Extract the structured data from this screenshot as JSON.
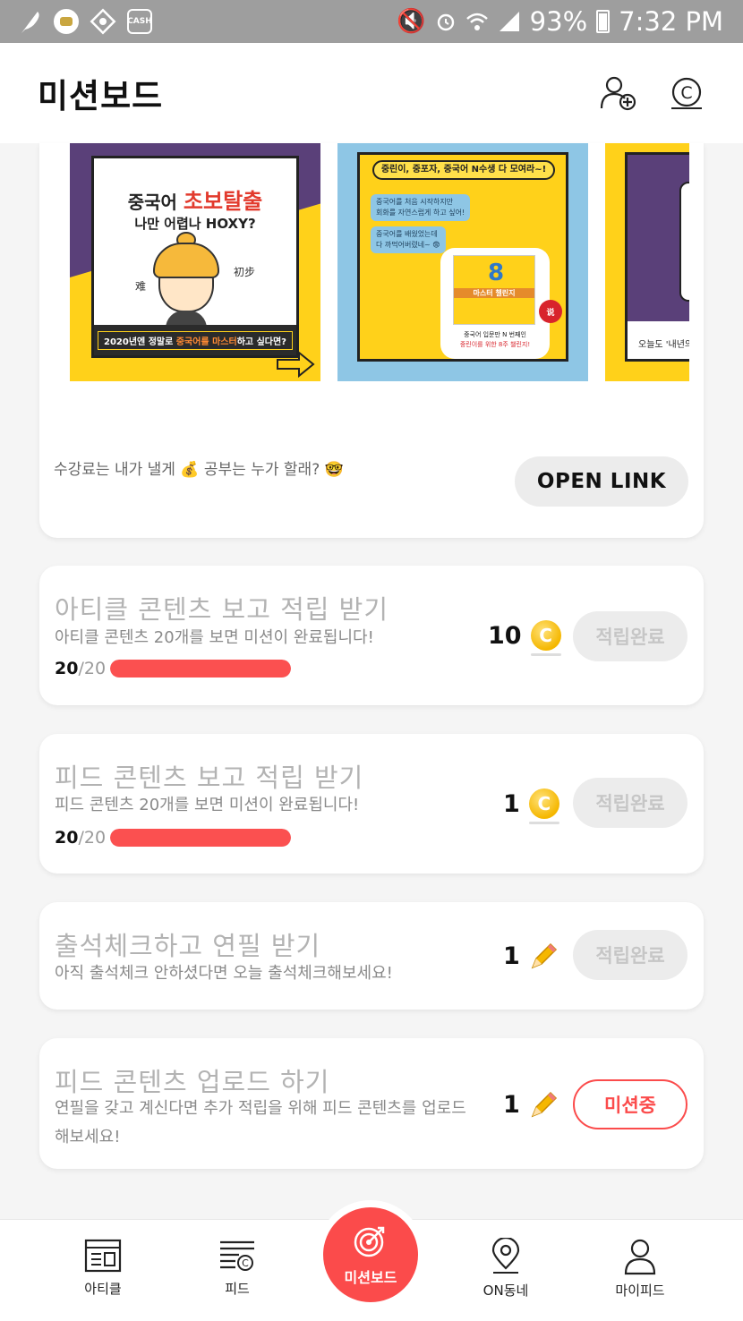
{
  "status_bar": {
    "battery": "93%",
    "time": "7:32 PM",
    "left_icons": [
      "feather-icon",
      "coin-app-icon",
      "diamond-app-icon",
      "cash-tv-icon"
    ],
    "cash_label": "CASH",
    "right_icons": [
      "mute-icon",
      "alarm-icon",
      "wifi-icon",
      "signal-icon",
      "battery-icon"
    ]
  },
  "header": {
    "title": "미션보드",
    "actions": [
      "add-friend-icon",
      "coin-icon"
    ],
    "coin_glyph": "C"
  },
  "banner": {
    "caption": "수강료는 내가 낼게 💰 공부는 누가 할래? 🤓",
    "open_link_label": "OPEN LINK",
    "slides": {
      "slide1": {
        "title_prefix": "중국어",
        "title_highlight": "초보탈출",
        "subtitle": "나만 어렵나 HOXY?",
        "side_left": "难",
        "side_right": "初步",
        "footer_a": "2020년엔 정말로 ",
        "footer_highlight": "중국어를 마스터",
        "footer_b": "하고 싶다면?"
      },
      "slide2": {
        "header": "중린이, 중포자, 중국어 N수생 다 모여라~!",
        "chat1_line1": "중국어를 처음 시작하지만",
        "chat1_line2": "회화를 자연스럽게 하고 싶어!",
        "chat2_line1": "중국어를 배웠었는데",
        "chat2_line2": "다 까먹어버렸네~ 😨",
        "poster_number": "8",
        "poster_text": "마스터 챌린지",
        "caption1": "중국어 입문만 N 번째인",
        "caption2": "중린이를 위한 8주 챌린지!",
        "logo": "说"
      },
      "slide3": {
        "caption": "오늘도 '내년의"
      }
    }
  },
  "missions": [
    {
      "title": "아티클 콘텐츠 보고 적립 받기",
      "desc": "아티클 콘텐츠 20개를 보면 미션이 완료됩니다!",
      "progress_current": "20",
      "progress_total": "/20",
      "progress_ratio": 1.0,
      "reward": "10",
      "reward_type": "coin",
      "button": "적립완료",
      "status": "done"
    },
    {
      "title": "피드 콘텐츠 보고 적립 받기",
      "desc": "피드 콘텐츠 20개를 보면 미션이 완료됩니다!",
      "progress_current": "20",
      "progress_total": "/20",
      "progress_ratio": 1.0,
      "reward": "1",
      "reward_type": "coin",
      "button": "적립완료",
      "status": "done"
    },
    {
      "title": "출석체크하고 연필 받기",
      "desc": "아직 출석체크 안하셨다면 오늘 출석체크해보세요!",
      "reward": "1",
      "reward_type": "pencil",
      "button": "적립완료",
      "status": "done"
    },
    {
      "title": "피드 콘텐츠 업로드 하기",
      "desc_line1": "연필을 갖고 계신다면 추가 적립을 위해 피드 콘텐츠를 업로드",
      "desc_line2": "해보세요!",
      "reward": "1",
      "reward_type": "pencil",
      "button": "미션중",
      "status": "active"
    }
  ],
  "bottom_nav": {
    "items": [
      {
        "label": "아티클",
        "icon": "article-icon"
      },
      {
        "label": "피드",
        "icon": "feed-icon"
      },
      {
        "label": "미션보드",
        "icon": "target-icon",
        "selected": true
      },
      {
        "label": "ON동네",
        "icon": "location-pin-icon"
      },
      {
        "label": "마이피드",
        "icon": "person-icon"
      }
    ]
  },
  "colors": {
    "accent": "#fb4b4b",
    "progress": "#fb5050",
    "coin": "#f5b700",
    "status_bar": "#9e9e9e",
    "banner_yellow": "#ffd11a",
    "banner_purple": "#5a4079",
    "banner_blue": "#8ec6e5"
  }
}
